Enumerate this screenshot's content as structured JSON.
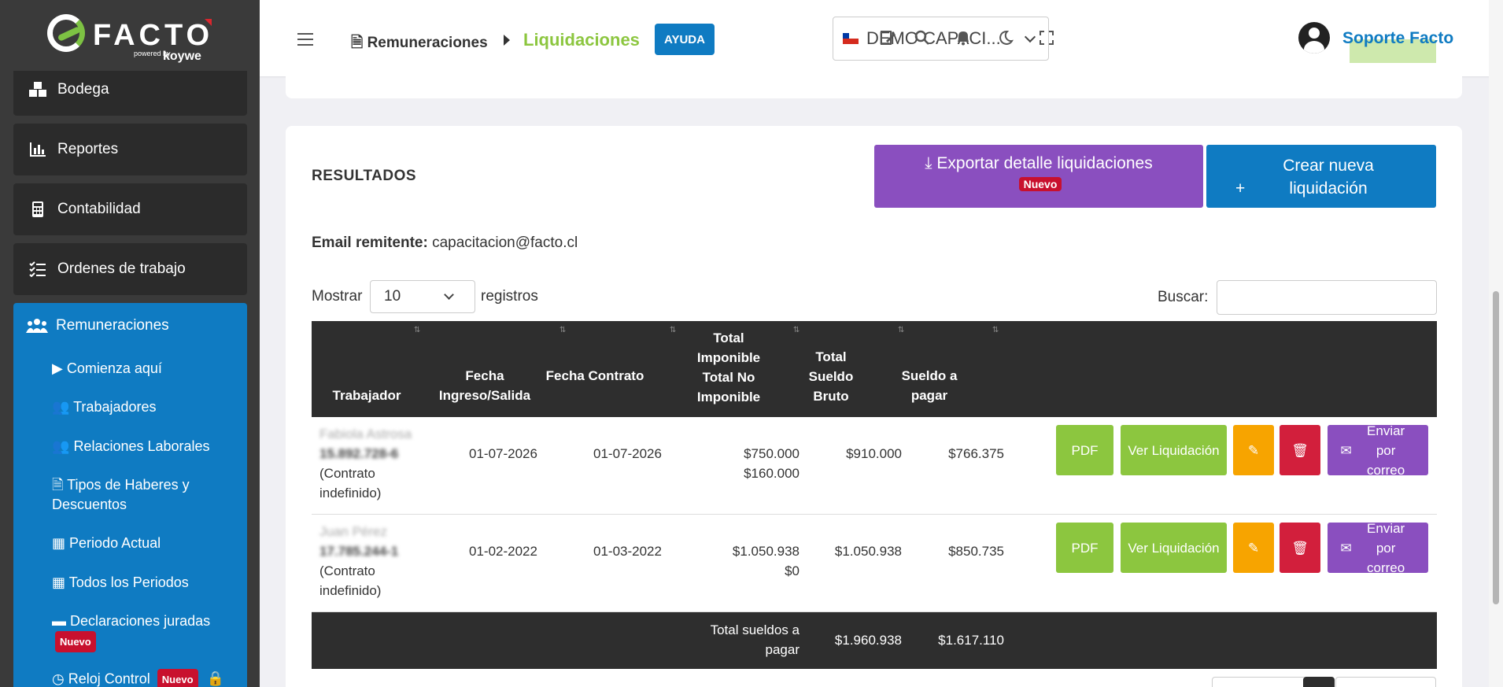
{
  "brand": {
    "name": "FACTO",
    "powered": "powered by",
    "partner": "koywe"
  },
  "sidebar": {
    "items": [
      {
        "label": "Bodega",
        "icon": "boxes-icon"
      },
      {
        "label": "Reportes",
        "icon": "bar-chart-icon"
      },
      {
        "label": "Contabilidad",
        "icon": "calculator-icon"
      },
      {
        "label": "Ordenes de trabajo",
        "icon": "task-list-icon"
      }
    ],
    "active": {
      "label": "Remuneraciones",
      "icon": "users-icon"
    },
    "subitems": [
      {
        "label": "Comienza aquí",
        "icon": "play-icon"
      },
      {
        "label": "Trabajadores",
        "icon": "users-icon"
      },
      {
        "label": "Relaciones Laborales",
        "icon": "user-group-icon"
      },
      {
        "label": "Tipos de Haberes y Descuentos",
        "icon": "file-icon"
      },
      {
        "label": "Periodo Actual",
        "icon": "calendar-day-icon"
      },
      {
        "label": "Todos los Periodos",
        "icon": "calendar-icon"
      },
      {
        "label": "Declaraciones juradas",
        "icon": "archive-icon",
        "badge": "Nuevo"
      },
      {
        "label": "Reloj Control",
        "icon": "clock-icon",
        "badge": "Nuevo"
      }
    ]
  },
  "header": {
    "breadcrumb_parent": "Remuneraciones",
    "breadcrumb_current": "Liquidaciones",
    "help_label": "AYUDA",
    "company": "DEMO CAPACI...",
    "user": "Soporte Facto"
  },
  "results": {
    "title": "RESULTADOS",
    "export_label": "Exportar detalle liquidaciones",
    "export_badge": "Nuevo",
    "create_label": "Crear nueva liquidación",
    "email_label": "Email remitente:",
    "email_value": "capacitacion@facto.cl",
    "show_label": "Mostrar",
    "page_size": "10",
    "records_label": "registros",
    "search_label": "Buscar:"
  },
  "table": {
    "columns": [
      "Trabajador",
      "Fecha Ingreso/Salida",
      "Fecha Contrato",
      "Total Imponible Total No Imponible",
      "Total Sueldo Bruto",
      "Sueldo a pagar"
    ],
    "rows": [
      {
        "name": "Fabiola Astrosa",
        "rut": "15.892.728-6",
        "contract": "(Contrato indefinido)",
        "fecha_ingreso": "01-07-2026",
        "fecha_contrato": "01-07-2026",
        "imponible": "$750.000",
        "no_imponible": "$160.000",
        "bruto": "$910.000",
        "pagar": "$766.375"
      },
      {
        "name": "Juan Pérez",
        "rut": "17.785.244-1",
        "contract": "(Contrato indefinido)",
        "fecha_ingreso": "01-02-2022",
        "fecha_contrato": "01-03-2022",
        "imponible": "$1.050.938",
        "no_imponible": "$0",
        "bruto": "$1.050.938",
        "pagar": "$850.735"
      }
    ],
    "actions": {
      "pdf": "PDF",
      "view": "Ver Liquidación",
      "email": "Enviar por correo"
    },
    "footer": {
      "label": "Total sueldos a pagar",
      "bruto": "$1.960.938",
      "pagar": "$1.617.110"
    }
  },
  "colors": {
    "sidebar_bg": "#3a3a3a",
    "active_blue": "#0f7bc2",
    "green": "#8cc63f",
    "purple": "#8a4fbf",
    "orange": "#f7a400",
    "red": "#d21f3c",
    "table_header": "#2e2e2e"
  }
}
